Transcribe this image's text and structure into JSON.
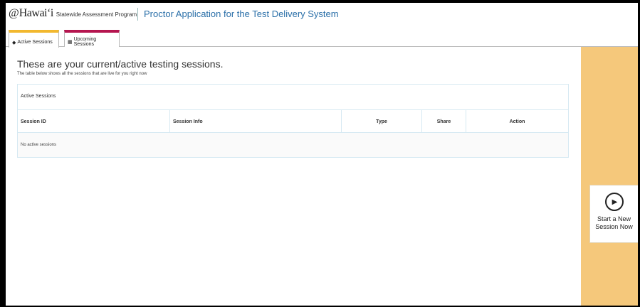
{
  "header": {
    "logo_mark": "@",
    "logo_word": "Hawai‘i",
    "logo_sub": "Statewide Assessment Program",
    "app_title": "Proctor Application for the Test Delivery System"
  },
  "tabs": [
    {
      "label": "Active Sessions",
      "icon": "pin-icon",
      "accent": "#f2b82f",
      "active": true
    },
    {
      "label": "Upcoming Sessions",
      "icon": "calendar-icon",
      "accent": "#b5154f",
      "active": false
    }
  ],
  "main": {
    "title": "These are your current/active testing sessions.",
    "subtitle": "The table below shows all the sessions that are live for you right now",
    "panel_title": "Active Sessions",
    "columns": [
      "Session ID",
      "Session Info",
      "Type",
      "Share",
      "Action"
    ],
    "empty_message": "No active sessions"
  },
  "sidebar": {
    "start_button": {
      "icon": "play-icon",
      "line1": "Start a New",
      "line2": "Session Now"
    },
    "background": "#f5c87b"
  },
  "colors": {
    "title_blue": "#2a6fa8",
    "active_tab": "#f2b82f",
    "upcoming_tab": "#b5154f",
    "panel_border": "#d6e9f2"
  }
}
